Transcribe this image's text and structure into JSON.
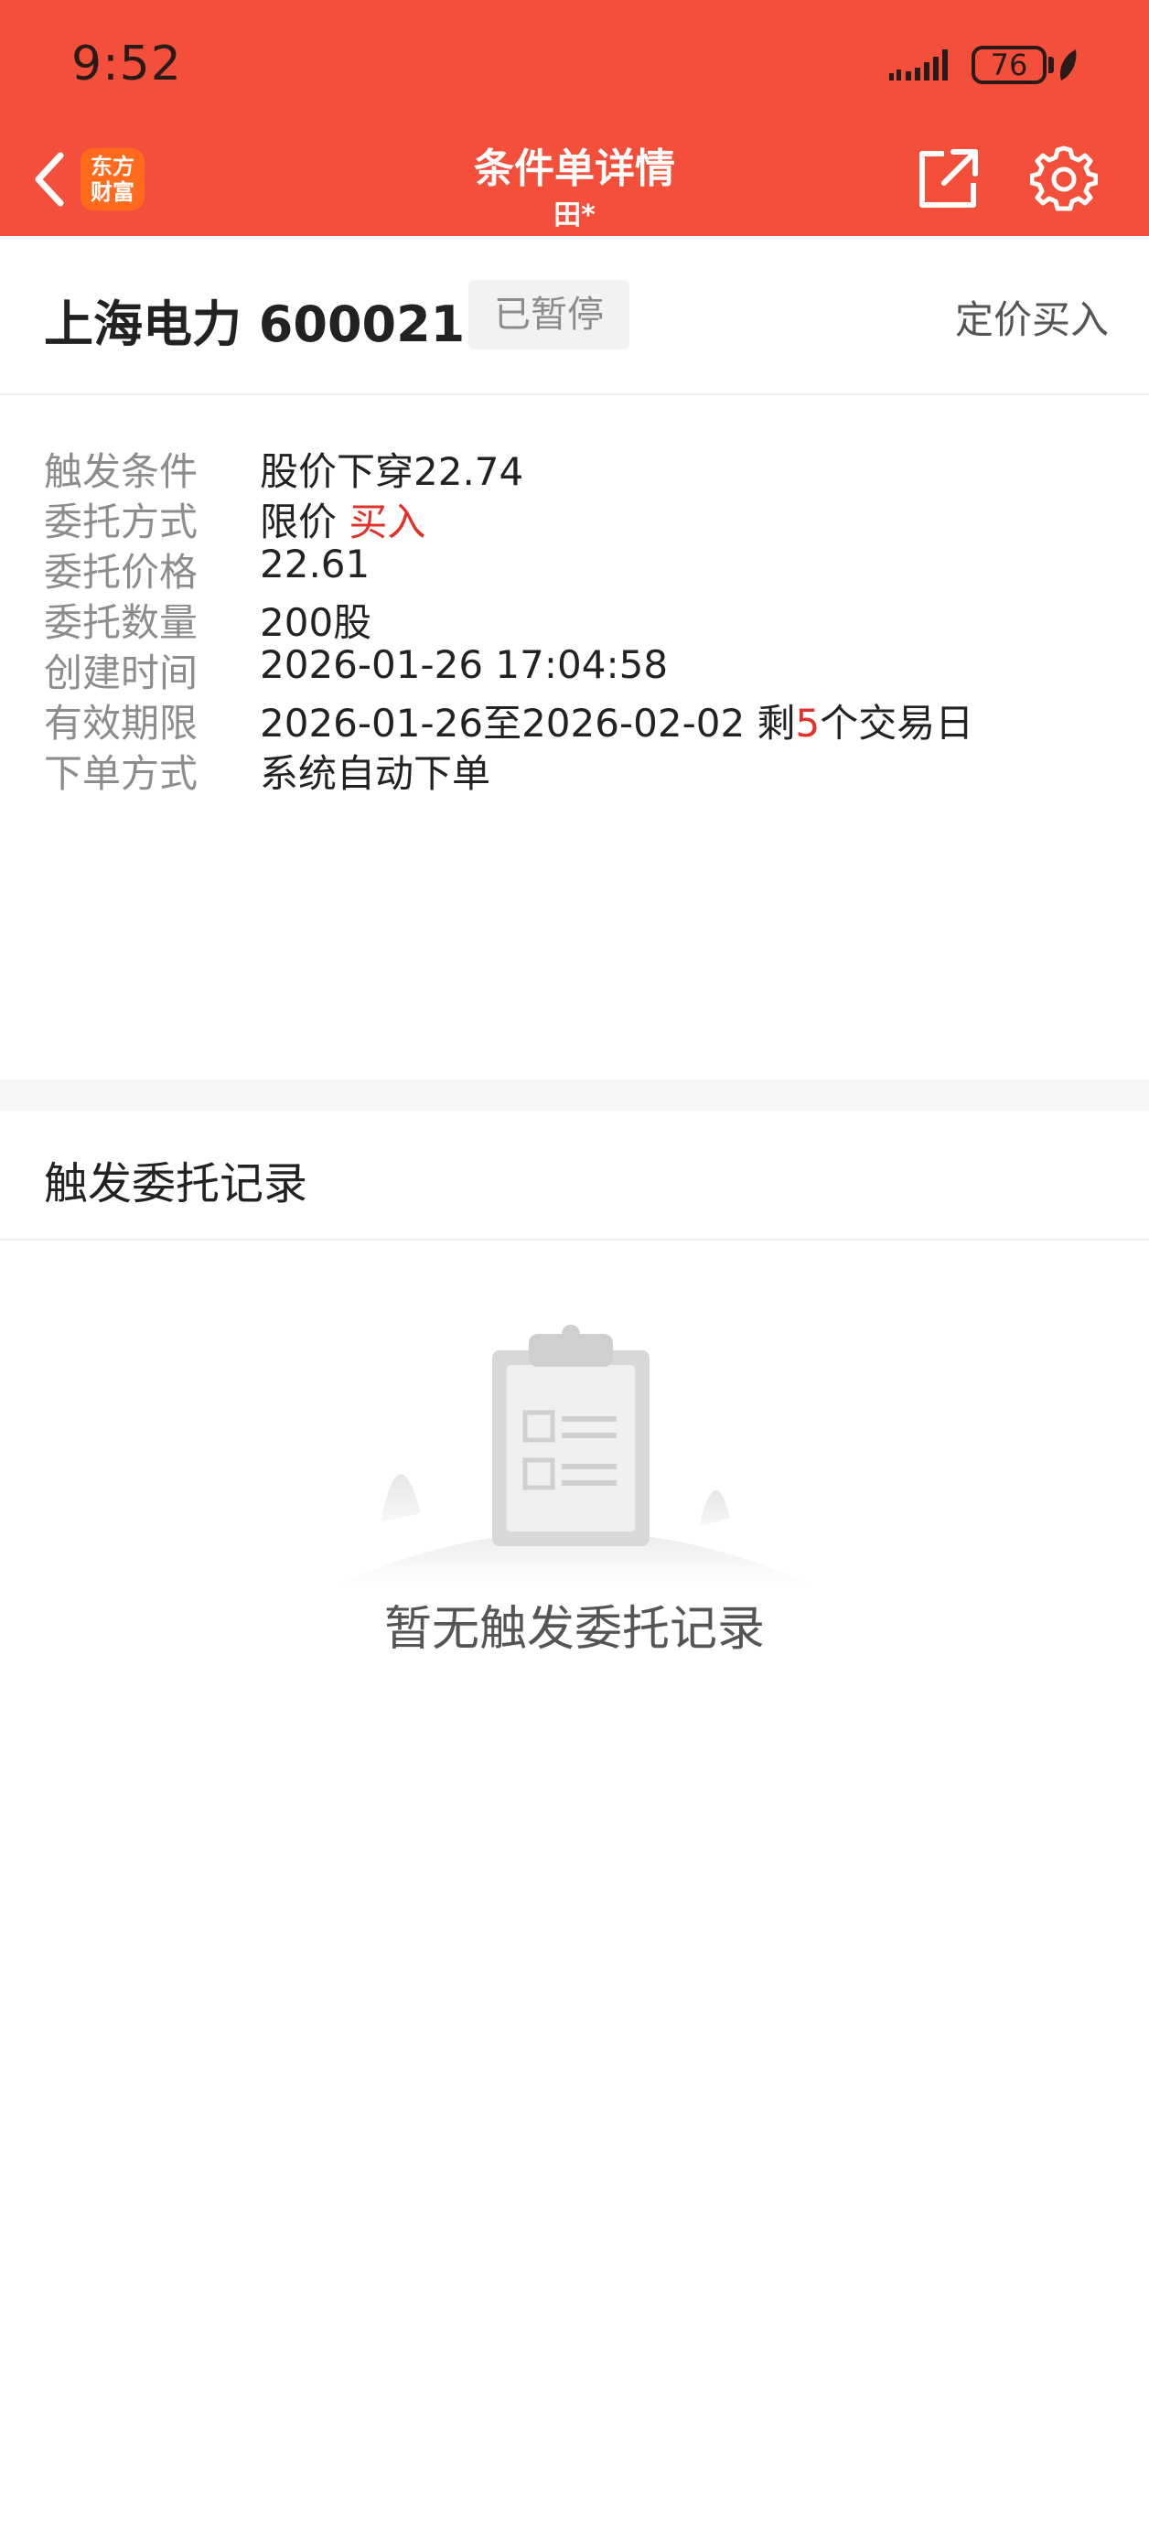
{
  "status_bar": {
    "time": "9:52",
    "battery": "76"
  },
  "header": {
    "title": "条件单详情",
    "subtitle": "田*",
    "logo_line1": "东方",
    "logo_line2": "财富"
  },
  "stock": {
    "name_code": "上海电力 600021",
    "status": "已暂停",
    "order_type": "定价买入"
  },
  "details": {
    "trigger": {
      "label": "触发条件",
      "value": "股价下穿22.74"
    },
    "method": {
      "label": "委托方式",
      "value": "限价",
      "side": "买入"
    },
    "price": {
      "label": "委托价格",
      "value": "22.61"
    },
    "quantity": {
      "label": "委托数量",
      "value": "200股"
    },
    "created": {
      "label": "创建时间",
      "value": "2026-01-26 17:04:58"
    },
    "validity": {
      "label": "有效期限",
      "value_prefix": "2026-01-26至2026-02-02 剩",
      "remaining": "5",
      "value_suffix": "个交易日"
    },
    "placement": {
      "label": "下单方式",
      "value": "系统自动下单"
    }
  },
  "records": {
    "title": "触发委托记录",
    "empty_text": "暂无触发委托记录"
  },
  "colors": {
    "header_bg": "#f44f3a",
    "accent_red": "#e0312b"
  },
  "icons": {
    "back": "chevron-left-icon",
    "share": "share-icon",
    "settings": "gear-icon",
    "empty": "clipboard-icon"
  }
}
